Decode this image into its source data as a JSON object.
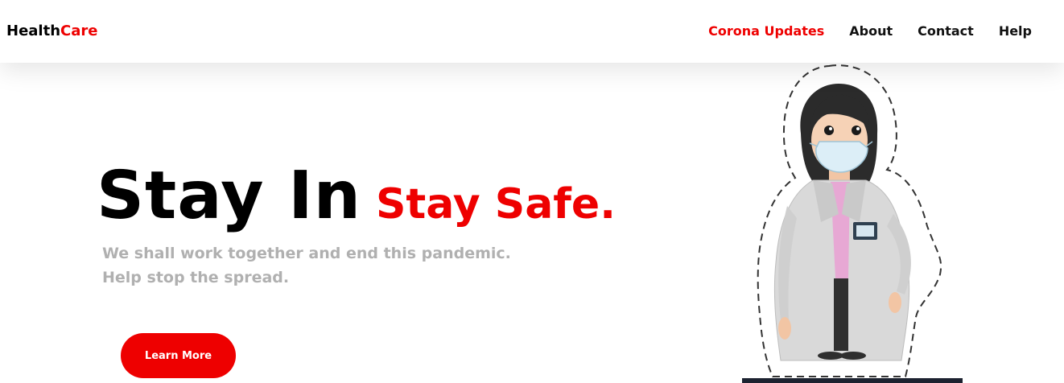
{
  "navbar": {
    "brand": {
      "part1": "Health",
      "part2": "Care"
    },
    "links": [
      {
        "label": "Corona Updates",
        "active": true
      },
      {
        "label": "About",
        "active": false
      },
      {
        "label": "Contact",
        "active": false
      },
      {
        "label": "Help",
        "active": false
      }
    ]
  },
  "hero": {
    "title_main": "Stay In",
    "title_accent": "Stay Safe.",
    "subtitle_line1": "We shall work together and end this pandemic.",
    "subtitle_line2": "Help stop the spread.",
    "cta_label": "Learn More"
  },
  "colors": {
    "accent": "#ee0000",
    "text": "#111111",
    "muted": "#b0b0b0",
    "background": "#ffffff"
  },
  "icons": {
    "illustration": "doctor-with-mask-illustration"
  }
}
